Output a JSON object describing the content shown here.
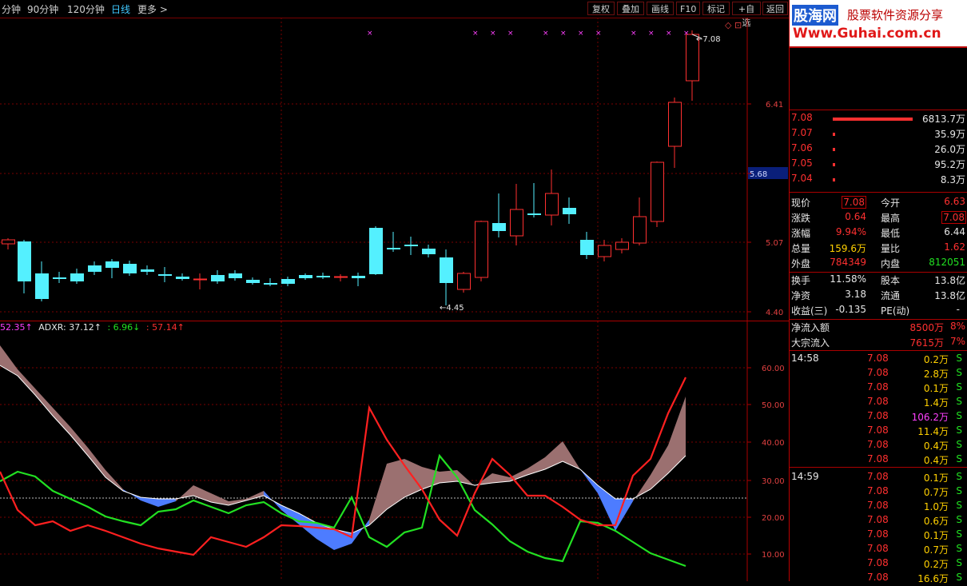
{
  "toolbar": {
    "periods": [
      "分钟",
      "90分钟",
      "120分钟",
      "日线",
      "更多 >"
    ],
    "active_period": "日线",
    "buttons": [
      "复权",
      "叠加",
      "画线",
      "F10",
      "标记",
      "+自选",
      "返回"
    ],
    "corner_icons": "◇ ⊡"
  },
  "logo": {
    "brand": "股海网",
    "slogan": "股票软件资源分享",
    "url": "Www.Guhai.com.cn"
  },
  "price_axis": {
    "labels": [
      "6.41",
      "5.68",
      "5.07",
      "4.40"
    ],
    "highlight": "5.68"
  },
  "annotations": {
    "high": "7.08",
    "low": "4.45"
  },
  "indicator_header": {
    "v1": "52.35↑",
    "adxr_label": "ADXR: 37.12↑",
    "v3": ": 6.96↓",
    "v4": ": 57.14↑"
  },
  "indicator_axis": [
    "60.00",
    "50.00",
    "40.00",
    "30.00",
    "20.00",
    "10.00"
  ],
  "order_book": [
    {
      "price": "7.08",
      "vol": "6813.7万",
      "bar": 1.0
    },
    {
      "price": "7.07",
      "vol": "35.9万",
      "bar": 0.02
    },
    {
      "price": "7.06",
      "vol": "26.0万",
      "bar": 0.02
    },
    {
      "price": "7.05",
      "vol": "95.2万",
      "bar": 0.02
    },
    {
      "price": "7.04",
      "vol": "8.3万",
      "bar": 0.02
    }
  ],
  "quote": {
    "xianjia_l": "现价",
    "xianjia_v": "7.08",
    "jinkai_l": "今开",
    "jinkai_v": "6.63",
    "zhangdie_l": "涨跌",
    "zhangdie_v": "0.64",
    "zuigao_l": "最高",
    "zuigao_v": "7.08",
    "zhangfu_l": "涨幅",
    "zhangfu_v": "9.94%",
    "zuidi_l": "最低",
    "zuidi_v": "6.44",
    "zongliang_l": "总量",
    "zongliang_v": "159.6万",
    "liangbi_l": "量比",
    "liangbi_v": "1.62",
    "waipan_l": "外盘",
    "waipan_v": "784349",
    "neipan_l": "内盘",
    "neipan_v": "812051"
  },
  "stats": {
    "huanshou_l": "换手",
    "huanshou_v": "11.58%",
    "guben_l": "股本",
    "guben_v": "13.8亿",
    "jingzi_l": "净资",
    "jingzi_v": "3.18",
    "liutong_l": "流通",
    "liutong_v": "13.8亿",
    "shouyi_l": "收益(三)",
    "shouyi_v": "-0.135",
    "pe_l": "PE(动)",
    "pe_v": "-"
  },
  "flows": {
    "net_l": "净流入额",
    "net_v": "8500万",
    "net_p": "8%",
    "block_l": "大宗流入",
    "block_v": "7615万",
    "block_p": "7%"
  },
  "ticks": [
    {
      "time": "14:58",
      "price": "7.08",
      "vol": "0.2万",
      "side": "S"
    },
    {
      "time": "",
      "price": "7.08",
      "vol": "2.8万",
      "side": "S"
    },
    {
      "time": "",
      "price": "7.08",
      "vol": "0.1万",
      "side": "S"
    },
    {
      "time": "",
      "price": "7.08",
      "vol": "1.4万",
      "side": "S"
    },
    {
      "time": "",
      "price": "7.08",
      "vol": "106.2万",
      "side": "S",
      "big": true
    },
    {
      "time": "",
      "price": "7.08",
      "vol": "11.4万",
      "side": "S"
    },
    {
      "time": "",
      "price": "7.08",
      "vol": "0.4万",
      "side": "S"
    },
    {
      "time": "",
      "price": "7.08",
      "vol": "0.4万",
      "side": "S"
    },
    {
      "time": "14:59",
      "price": "7.08",
      "vol": "0.1万",
      "side": "S"
    },
    {
      "time": "",
      "price": "7.08",
      "vol": "0.7万",
      "side": "S"
    },
    {
      "time": "",
      "price": "7.08",
      "vol": "1.0万",
      "side": "S"
    },
    {
      "time": "",
      "price": "7.08",
      "vol": "0.6万",
      "side": "S"
    },
    {
      "time": "",
      "price": "7.08",
      "vol": "0.1万",
      "side": "S"
    },
    {
      "time": "",
      "price": "7.08",
      "vol": "0.7万",
      "side": "S"
    },
    {
      "time": "",
      "price": "7.08",
      "vol": "0.2万",
      "side": "S"
    },
    {
      "time": "",
      "price": "7.08",
      "vol": "16.6万",
      "side": "S"
    }
  ],
  "colors": {
    "up": "#ff3030",
    "down": "#54f0ff",
    "grid": "#7a0000",
    "pdi": "#ff2020",
    "mdi": "#22e022",
    "adx": "#ffffff",
    "band_up": "#9b7070",
    "band_down": "#4d7cff"
  }
}
